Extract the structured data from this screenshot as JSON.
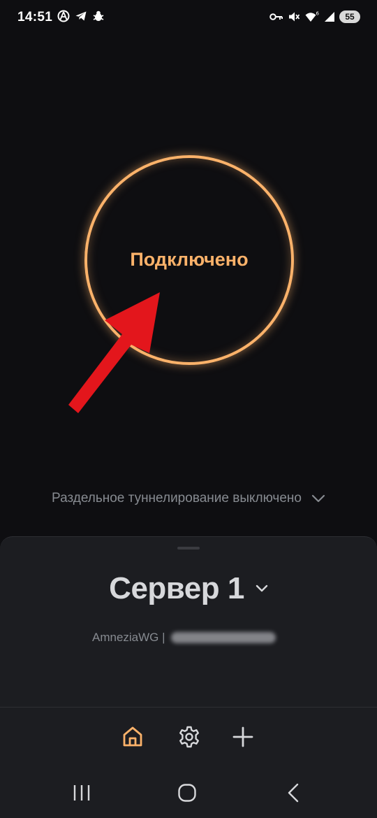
{
  "status_bar": {
    "time": "14:51",
    "battery": "55",
    "left_icons": [
      "vpn-app-icon",
      "telegram-icon",
      "bug-icon"
    ],
    "right_icons": [
      "vpn-key-icon",
      "mute-icon",
      "wifi-6-icon",
      "signal-icon",
      "battery-icon"
    ]
  },
  "connection": {
    "status_label": "Подключено",
    "accent_color": "#fbb26a"
  },
  "split_tunneling": {
    "label": "Раздельное туннелирование выключено"
  },
  "server": {
    "name": "Сервер 1",
    "protocol": "AmneziaWG |"
  },
  "tabs": [
    {
      "name": "home",
      "icon": "home-icon",
      "active": true
    },
    {
      "name": "settings",
      "icon": "gear-icon",
      "active": false
    },
    {
      "name": "add",
      "icon": "plus-icon",
      "active": false
    }
  ],
  "colors": {
    "background": "#0e0e11",
    "sheet": "#1c1d21",
    "muted_text": "#878b91",
    "active_tab": "#fbb26a",
    "inactive_tab": "#d7d8db",
    "annotation_arrow": "#e3161c"
  }
}
